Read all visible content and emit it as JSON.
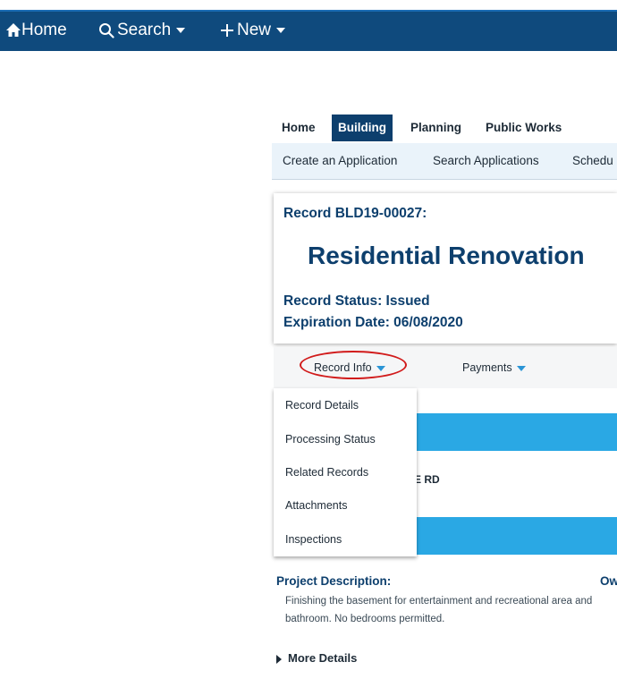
{
  "topnav": {
    "home_label": "Home",
    "search_label": "Search",
    "new_label": "New"
  },
  "portal_tabs": [
    "Home",
    "Building",
    "Planning",
    "Public Works"
  ],
  "active_tab": "Building",
  "subnav": [
    "Create an Application",
    "Search Applications",
    "Schedu"
  ],
  "record": {
    "id_line": "Record BLD19-00027:",
    "title": "Residential Renovation",
    "status_line": "Record Status: Issued",
    "expiration_line": "Expiration Date: 06/08/2020"
  },
  "record_tabs": {
    "record_info": "Record Info",
    "payments": "Payments"
  },
  "record_info_menu": [
    "Record Details",
    "Processing Status",
    "Related Records",
    "Attachments",
    "Inspections"
  ],
  "address_fragment": "AGE RD",
  "project": {
    "label": "Project Description:",
    "owner_fragment": "Ow",
    "text": "Finishing the basement for entertainment and recreational area and bathroom. No bedrooms permitted."
  },
  "more_details": "More Details",
  "colors": {
    "topbar": "#0f4a7d",
    "brand_text": "#0d3f6d",
    "band": "#2aa8e4",
    "annotation_circle": "#d11b1b"
  }
}
